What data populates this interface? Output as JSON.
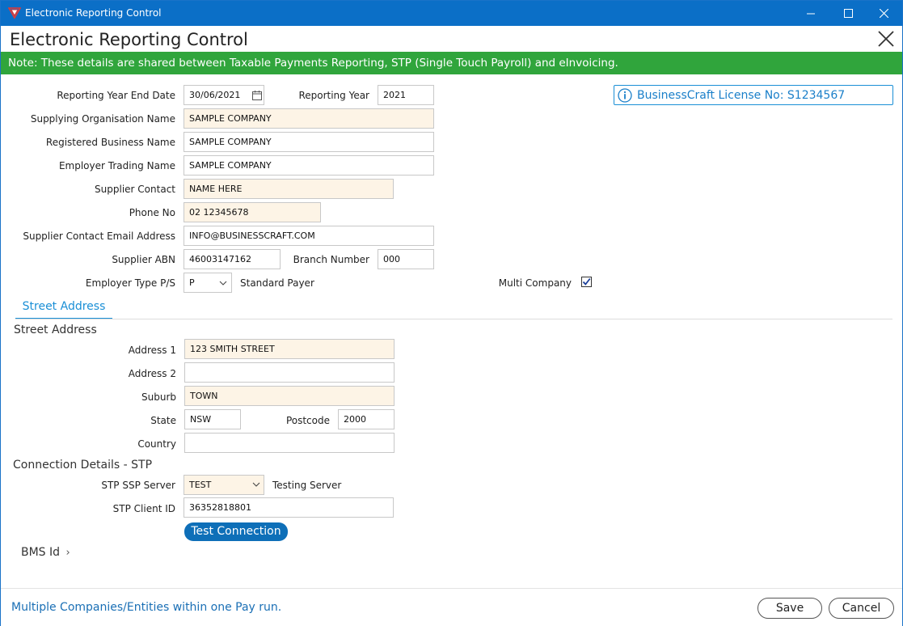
{
  "window": {
    "titlebar_title": "Electronic Reporting Control",
    "header_title": "Electronic Reporting Control",
    "note": "Note: These details are shared between Taxable Payments Reporting, STP (Single Touch Payroll) and eInvoicing.",
    "license": "BusinessCraft License No: S1234567"
  },
  "form": {
    "reporting_year_end_date": {
      "label": "Reporting Year End Date",
      "value": "30/06/2021"
    },
    "reporting_year": {
      "label": "Reporting Year",
      "value": "2021"
    },
    "supplying_org_name": {
      "label": "Supplying Organisation Name",
      "value": "SAMPLE COMPANY"
    },
    "registered_business_name": {
      "label": "Registered Business Name",
      "value": "SAMPLE COMPANY"
    },
    "employer_trading_name": {
      "label": "Employer Trading Name",
      "value": "SAMPLE COMPANY"
    },
    "supplier_contact": {
      "label": "Supplier Contact",
      "value": "NAME HERE"
    },
    "phone_no": {
      "label": "Phone No",
      "value": "02 12345678"
    },
    "supplier_email": {
      "label": "Supplier Contact Email Address",
      "value": "INFO@BUSINESSCRAFT.COM"
    },
    "supplier_abn": {
      "label": "Supplier ABN",
      "value": "46003147162"
    },
    "branch_number": {
      "label": "Branch Number",
      "value": "000"
    },
    "employer_type": {
      "label": "Employer Type P/S",
      "value": "P",
      "description": "Standard Payer"
    },
    "multi_company": {
      "label": "Multi Company",
      "checked": true
    }
  },
  "tabs": [
    {
      "label": "Street Address",
      "active": true
    }
  ],
  "address": {
    "section_title": "Street Address",
    "address1": {
      "label": "Address 1",
      "value": "123 SMITH STREET"
    },
    "address2": {
      "label": "Address 2",
      "value": ""
    },
    "suburb": {
      "label": "Suburb",
      "value": "TOWN"
    },
    "state": {
      "label": "State",
      "value": "NSW"
    },
    "postcode": {
      "label": "Postcode",
      "value": "2000"
    },
    "country": {
      "label": "Country",
      "value": ""
    }
  },
  "connection": {
    "section_title": "Connection Details - STP",
    "stp_ssp_server": {
      "label": "STP SSP Server",
      "value": "TEST",
      "description": "Testing Server"
    },
    "stp_client_id": {
      "label": "STP Client ID",
      "value": "36352818801"
    },
    "test_button": "Test Connection"
  },
  "bms": {
    "label": "BMS Id",
    "chevron": "›"
  },
  "footer": {
    "note": "Multiple Companies/Entities within one Pay run.",
    "save_label": "Save",
    "cancel_label": "Cancel"
  },
  "colors": {
    "titlebar": "#0b6fc7",
    "note_bar": "#30a53c",
    "accent": "#1a8fd6",
    "required_field": "#fdf4e6",
    "primary_button": "#0e6fb8"
  },
  "icons": {
    "app": "app-logo-icon",
    "minimize": "minimize-icon",
    "maximize": "maximize-icon",
    "close": "close-icon",
    "info": "info-icon",
    "calendar": "calendar-icon",
    "dropdown": "chevron-down-icon",
    "checkmark": "checkmark-icon"
  }
}
